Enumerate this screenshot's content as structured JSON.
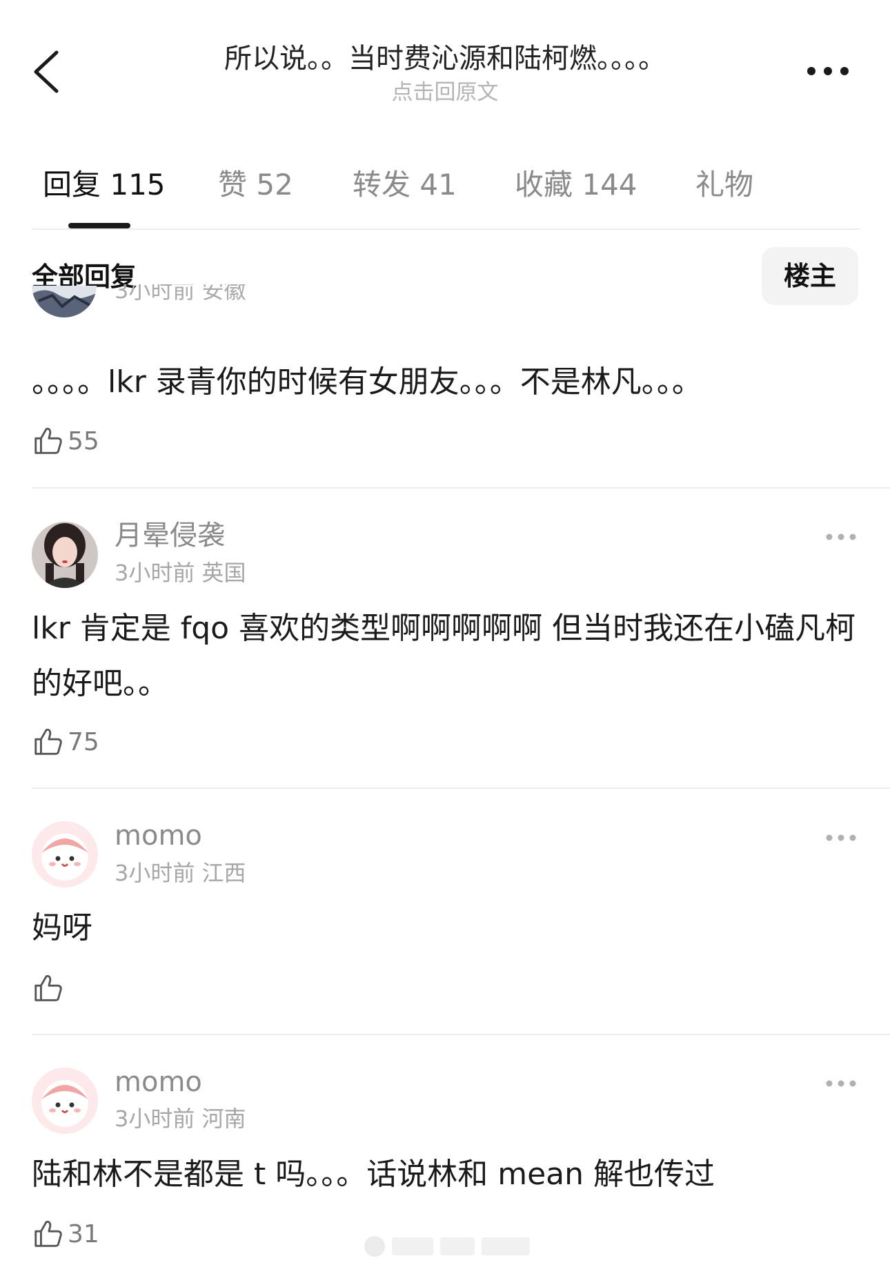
{
  "header": {
    "title": "所以说。。当时费沁源和陆柯燃。。。。",
    "subtitle": "点击回原文",
    "back_icon": "chevron-left-icon",
    "more_icon": "more-horizontal-icon"
  },
  "tabs": [
    {
      "label": "回复 115",
      "active": true
    },
    {
      "label": "赞 52"
    },
    {
      "label": "转发 41"
    },
    {
      "label": "收藏 144"
    },
    {
      "label": "礼物"
    }
  ],
  "filter": {
    "title": "全部回复",
    "op_button": "楼主"
  },
  "comments": [
    {
      "meta": "3小时前 安徽",
      "text": "。。。。lkr 录青你的时候有女朋友。。。不是林凡。。。",
      "likes": "55"
    },
    {
      "username": "月晕侵袭",
      "meta": "3小时前 英国",
      "text": "lkr 肯定是 fqo 喜欢的类型啊啊啊啊啊 但当时我还在小磕凡柯的好吧。。",
      "likes": "75"
    },
    {
      "username": "momo",
      "meta": "3小时前 江西",
      "text": "妈呀",
      "likes": ""
    },
    {
      "username": "momo",
      "meta": "3小时前 河南",
      "text": "陆和林不是都是 t 吗。。。话说林和 mean 解也传过",
      "likes": "31"
    }
  ],
  "colors": {
    "primary_text": "#1a1a1a",
    "secondary_text": "#8a8a8a",
    "divider": "#ececec",
    "button_bg": "#f3f3f3"
  }
}
